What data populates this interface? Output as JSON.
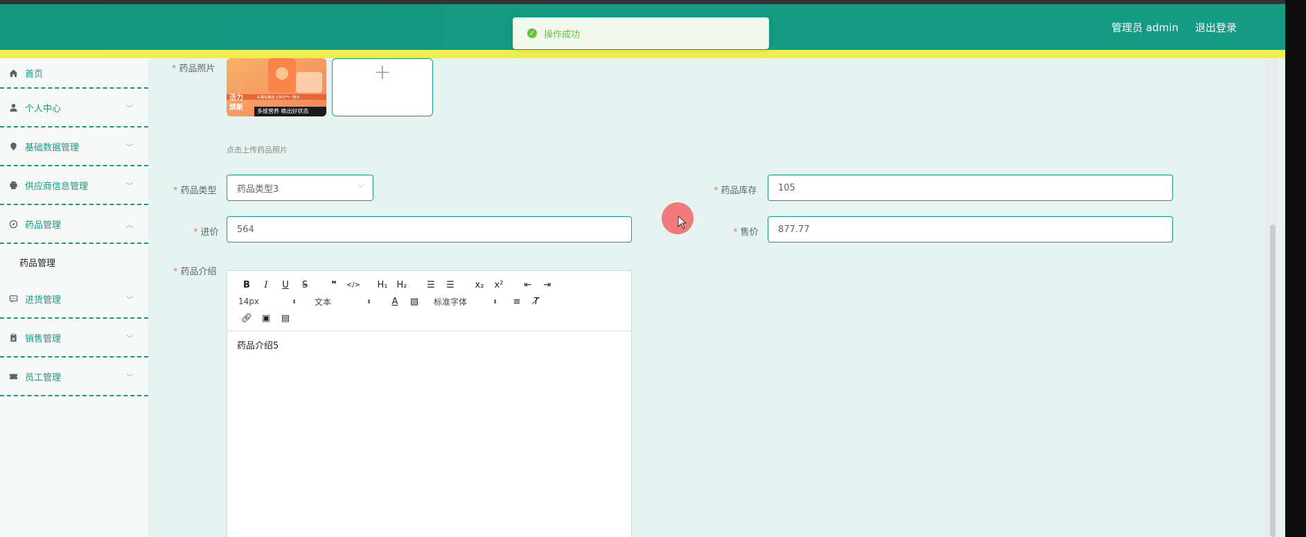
{
  "header": {
    "user_label": "管理员 admin",
    "logout_label": "退出登录"
  },
  "toast": {
    "message": "操作成功"
  },
  "sidebar": {
    "items": [
      {
        "label": "首页",
        "icon": "home-icon"
      },
      {
        "label": "个人中心",
        "icon": "user-icon"
      },
      {
        "label": "基础数据管理",
        "icon": "location-icon"
      },
      {
        "label": "供应商信息管理",
        "icon": "printer-icon"
      },
      {
        "label": "药品管理",
        "icon": "compass-icon"
      },
      {
        "label": "进货管理",
        "icon": "chat-icon"
      },
      {
        "label": "销售管理",
        "icon": "clipboard-icon"
      },
      {
        "label": "员工管理",
        "icon": "ticket-icon"
      }
    ],
    "sub_item": "药品管理"
  },
  "form": {
    "photo_label": "药品照片",
    "photo_hint": "点击上传药品照片",
    "photo_text": {
      "line1": "活力",
      "line2": "焕新",
      "banner": "多维营养 唤出好状态",
      "small": "头等车精选 让你元气一整天"
    },
    "type_label": "药品类型",
    "type_value": "药品类型3",
    "stock_label": "药品库存",
    "stock_value": "105",
    "purchase_label": "进价",
    "purchase_value": "564",
    "sale_label": "售价",
    "sale_value": "877.77",
    "intro_label": "药品介绍",
    "intro_value": "药品介绍5"
  },
  "editor": {
    "font_size": "14px",
    "text_style": "文本",
    "font_family": "标准字体"
  },
  "colors": {
    "primary": "#159a84",
    "header_accent": "#f0ee4f",
    "toast_bg": "#f0f9eb",
    "toast_text": "#67c23a",
    "required": "#f56c6c"
  }
}
